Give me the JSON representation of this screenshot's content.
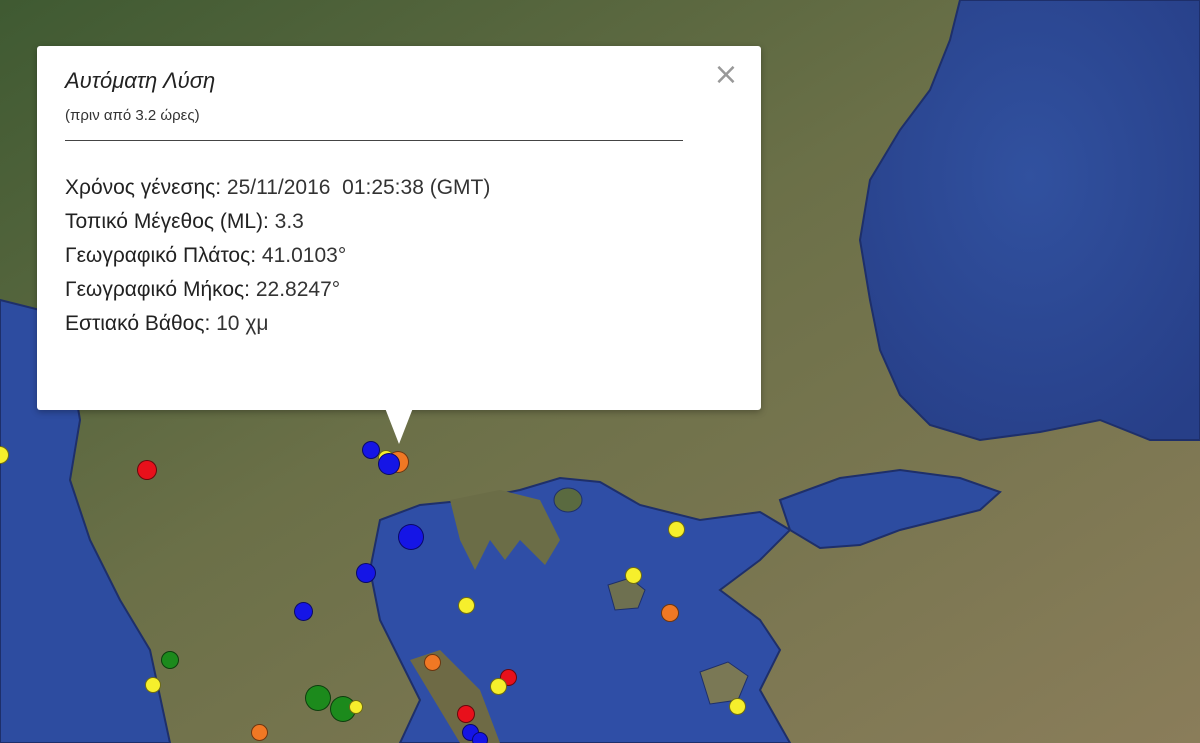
{
  "info_window": {
    "title": "Αυτόματη Λύση",
    "subtitle": "(πριν από 3.2 ώρες)",
    "close_icon": "close-icon",
    "rows": [
      {
        "label": "Χρόνος γένεσης: ",
        "value": "25/11/2016  01:25:38 (GMT)"
      },
      {
        "label": "Τοπικό Μέγεθος (ML): ",
        "value": "3.3"
      },
      {
        "label": "Γεωγραφικό Πλάτος: ",
        "value": "41.0103°"
      },
      {
        "label": "Γεωγραφικό Μήκος: ",
        "value": "22.8247°"
      },
      {
        "label": "Εστιακό Βάθος: ",
        "value": "10 χμ"
      }
    ]
  },
  "map": {
    "land_color": "#5f6a45",
    "sea_color": "#2d4c9e",
    "marker_colors": {
      "red": "#e8101b",
      "orange": "#f07824",
      "yellow": "#f6ef2c",
      "green": "#1c8a1c",
      "blue": "#1515e6"
    }
  }
}
